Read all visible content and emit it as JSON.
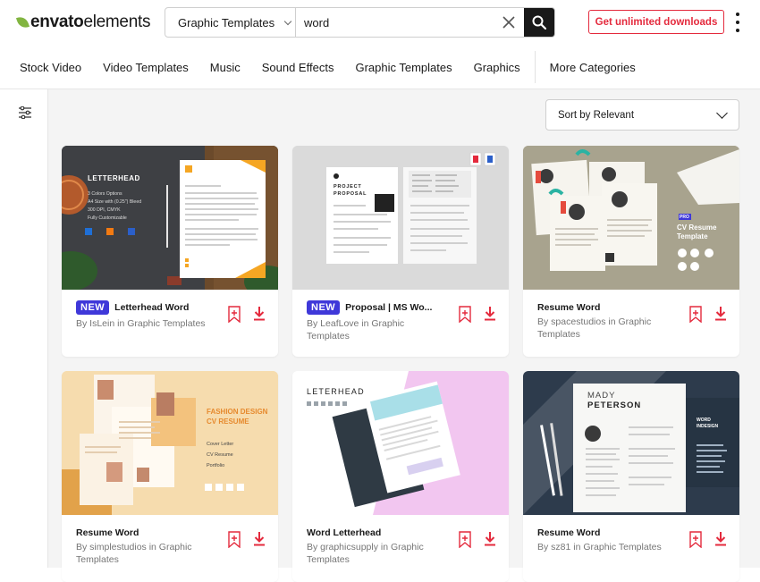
{
  "header": {
    "logo_bold": "envato",
    "logo_light": "elements",
    "category_select": "Graphic Templates",
    "search_value": "word",
    "cta_label": "Get unlimited downloads"
  },
  "nav": {
    "items": [
      "Stock Video",
      "Video Templates",
      "Music",
      "Sound Effects",
      "Graphic Templates",
      "Graphics"
    ],
    "more_label": "More Categories"
  },
  "sort": {
    "label": "Sort by Relevant"
  },
  "cards": [
    {
      "badge": "NEW",
      "title": "Letterhead Word",
      "byline": "By IsLein in Graphic Templates",
      "thumb_letterhead": "LETTERHEAD",
      "thumb_lines": [
        "3 Colors Options",
        "A4 Size with (0.25\") Bleed",
        "300 DPI, CMYK",
        "Fully Customizable"
      ]
    },
    {
      "badge": "NEW",
      "title": "Proposal | MS Wo...",
      "byline": "By LeafLove in Graphic Templates",
      "thumb_heading": "PROJECT PROPOSAL"
    },
    {
      "badge": "",
      "title": "Resume Word",
      "byline": "By spacestudios in Graphic Templates",
      "thumb_pro": "PRO",
      "thumb_heading": "CV Resume Template"
    },
    {
      "badge": "",
      "title": "Resume Word",
      "byline": "By simplestudios in Graphic Templates",
      "thumb_heading1": "FASHION DESIGN",
      "thumb_heading2": "CV RESUME",
      "thumb_list": [
        "Cover Letter",
        "CV Resume",
        "Portfolio"
      ]
    },
    {
      "badge": "",
      "title": "Word Letterhead",
      "byline": "By graphicsupply in Graphic Templates",
      "thumb_heading": "LETERHEAD"
    },
    {
      "badge": "",
      "title": "Resume Word",
      "byline": "By sz81 in Graphic Templates",
      "thumb_name1": "MADY",
      "thumb_name2": "PETERSON",
      "thumb_side": "WORD INDESIGN"
    }
  ],
  "colors": {
    "accent": "#e42a3d",
    "badge": "#3f38d9",
    "envato_green": "#82b541"
  }
}
